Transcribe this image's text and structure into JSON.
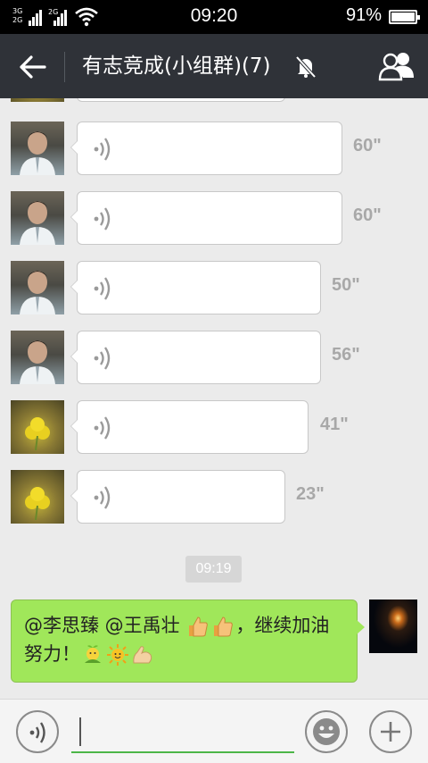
{
  "status": {
    "network_a": "3G",
    "network_b": "2G",
    "network_c": "2G",
    "network_d": "2G",
    "time": "09:20",
    "battery": "91%"
  },
  "header": {
    "title": "有志竞成(小组群)(7)"
  },
  "messages": [
    {
      "duration": "60\""
    },
    {
      "duration": "60\""
    },
    {
      "duration": "50\""
    },
    {
      "duration": "56\""
    },
    {
      "duration": "41\""
    },
    {
      "duration": "23\""
    }
  ],
  "timestamp": "09:19",
  "outgoing": {
    "text_part1": "@李思臻 @王禹壮 ",
    "text_part2": "，继续加油努力！"
  },
  "colors": {
    "header_bg": "#2f3238",
    "outgoing_bubble": "#a0e75a",
    "input_underline": "#4cb648"
  }
}
